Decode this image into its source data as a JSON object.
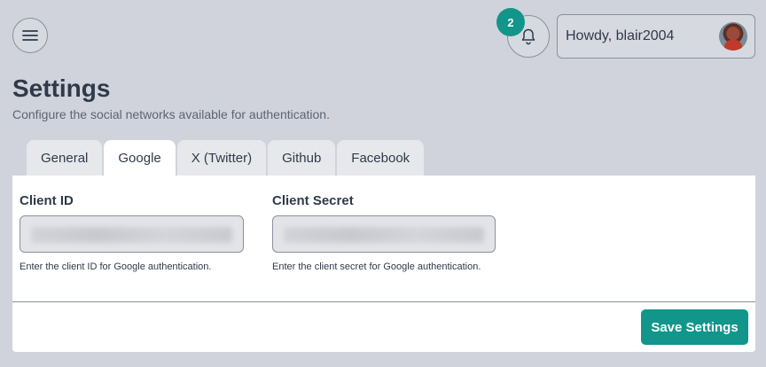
{
  "header": {
    "notification_count": "2",
    "greeting": "Howdy, blair2004"
  },
  "page": {
    "title": "Settings",
    "subtitle": "Configure the social networks available for authentication."
  },
  "tabs": [
    {
      "label": "General",
      "active": false
    },
    {
      "label": "Google",
      "active": true
    },
    {
      "label": "X (Twitter)",
      "active": false
    },
    {
      "label": "Github",
      "active": false
    },
    {
      "label": "Facebook",
      "active": false
    }
  ],
  "form": {
    "client_id": {
      "label": "Client ID",
      "help": "Enter the client ID for Google authentication."
    },
    "client_secret": {
      "label": "Client Secret",
      "help": "Enter the client secret for Google authentication."
    },
    "save_label": "Save Settings"
  },
  "icons": {
    "menu": "hamburger-menu-icon",
    "notifications": "bell-icon",
    "avatar": "user-avatar"
  },
  "colors": {
    "accent": "#12958a",
    "background": "#d0d3db"
  }
}
